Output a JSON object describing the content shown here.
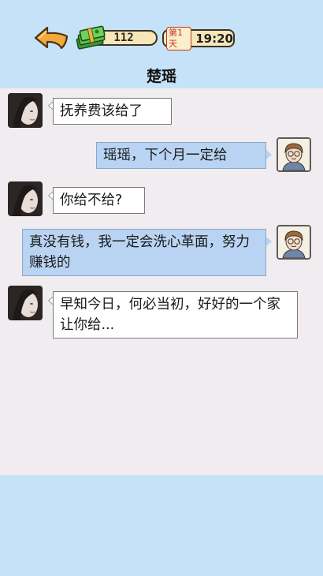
{
  "header": {
    "money": "112",
    "day_label": "第1天",
    "time": "19:20"
  },
  "chat": {
    "title": "楚瑶",
    "messages": [
      {
        "sender": "her",
        "text": "抚养费该给了"
      },
      {
        "sender": "me",
        "text": "瑶瑶，下个月一定给"
      },
      {
        "sender": "her",
        "text": "你给不给?"
      },
      {
        "sender": "me",
        "text": "真没有钱，我一定会洗心革面，努力赚钱的"
      },
      {
        "sender": "her",
        "text": "早知今日，何必当初，好好的一个家让你给..."
      }
    ]
  },
  "colors": {
    "background": "#c6e2f8",
    "chat_area": "#f1ecef",
    "my_bubble": "#b9d4f3",
    "her_bubble": "#ffffff"
  },
  "icons": [
    "back-arrow-icon",
    "money-stack-icon"
  ]
}
